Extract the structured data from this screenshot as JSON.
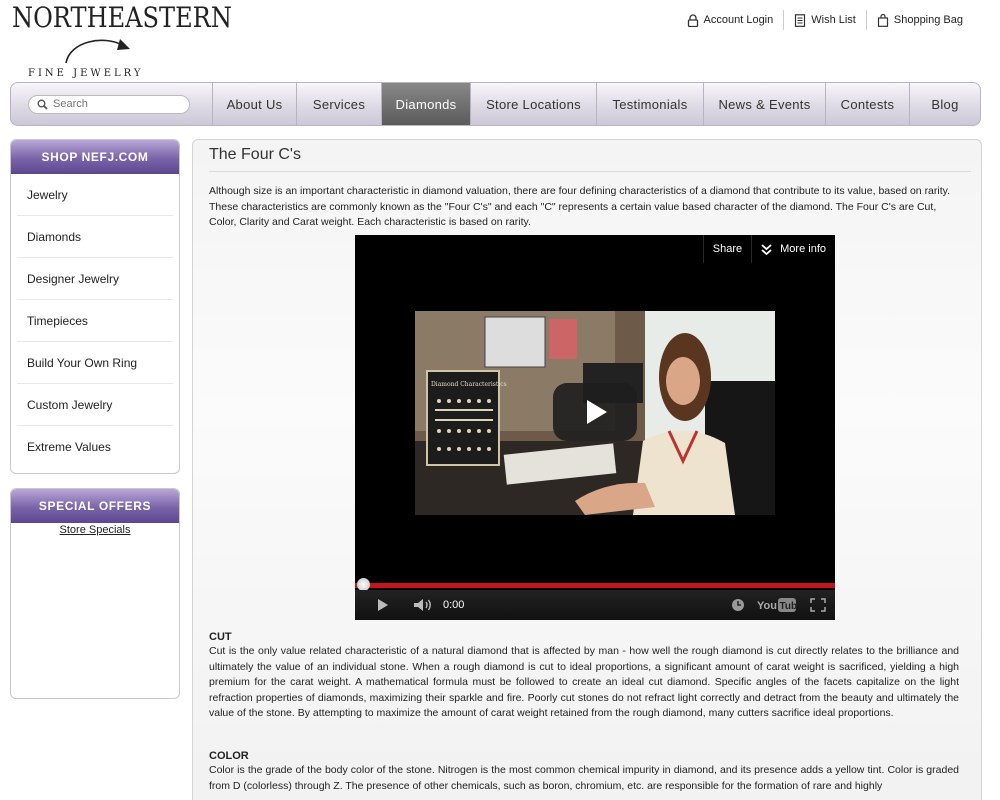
{
  "brand": {
    "logo_top": "NORTHEASTERN",
    "logo_bottom": "FINE JEWELRY"
  },
  "utility": {
    "account_login": "Account Login",
    "wish_list": "Wish List",
    "shopping_bag": "Shopping Bag"
  },
  "nav": {
    "search_placeholder": "Search",
    "items": [
      "About Us",
      "Services",
      "Diamonds",
      "Store Locations",
      "Testimonials",
      "News & Events",
      "Contests",
      "Blog"
    ],
    "active": "Diamonds"
  },
  "sidebar": {
    "shop_title": "SHOP NEFJ.COM",
    "shop_items": [
      "Jewelry",
      "Diamonds",
      "Designer Jewelry",
      "Timepieces",
      "Build Your Own Ring",
      "Custom Jewelry",
      "Extreme Values"
    ],
    "offers_title": "SPECIAL OFFERS",
    "offers_link": "Store Specials"
  },
  "main": {
    "title": "The Four C's",
    "intro": "Although size is an important characteristic in diamond valuation, there are four defining characteristics of a diamond that contribute to its value, based on rarity. These characteristics are commonly known as the \"Four C's\" and each \"C\" represents a certain value based character of the diamond. The Four C's are Cut, Color, Clarity and Carat weight. Each characteristic is based on rarity.",
    "video": {
      "share_label": "Share",
      "more_info_label": "More info",
      "time": "0:00",
      "progress": 0,
      "poster_sign": "Diamond Characteristics"
    },
    "cut": {
      "heading": "CUT",
      "body": "Cut is the only value related characteristic of a natural diamond that is affected by man - how well the rough diamond is cut directly relates to the brilliance and ultimately the value of an individual stone. When a rough diamond is cut to ideal proportions, a significant amount of carat weight is sacrificed, yielding a high premium for the carat weight. A mathematical formula must be followed to create an ideal cut diamond. Specific angles of the facets capitalize on the light refraction properties of diamonds, maximizing their sparkle and fire. Poorly cut stones do not refract light correctly and detract from the beauty and ultimately the value of the stone. By attempting to maximize the amount of carat weight retained from the rough diamond, many cutters sacrifice ideal proportions."
    },
    "color": {
      "heading": "COLOR",
      "body": "Color is the grade of the body color of the stone. Nitrogen is the most common chemical impurity in diamond, and its presence adds a yellow tint. Color is graded from D (colorless) through Z. The presence of other chemicals, such as boron, chromium, etc. are responsible for the formation of rare and highly"
    }
  },
  "colors": {
    "accent_purple": "#6b55a0",
    "nav_active": "#6a6a6a",
    "progress_red": "#c4151c"
  }
}
